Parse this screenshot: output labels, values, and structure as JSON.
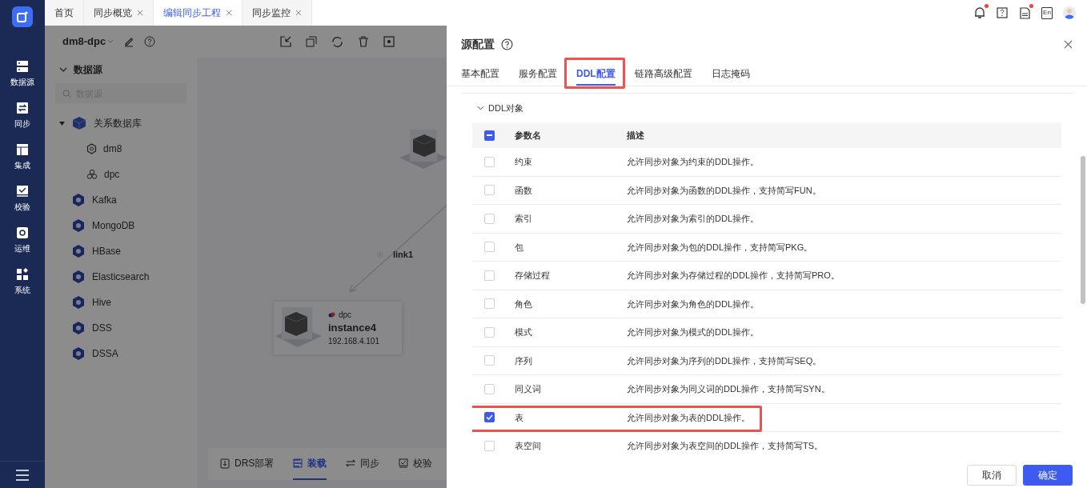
{
  "nav": {
    "items": [
      {
        "label": "数据源"
      },
      {
        "label": "同步"
      },
      {
        "label": "集成"
      },
      {
        "label": "校验"
      },
      {
        "label": "运维"
      },
      {
        "label": "系统"
      }
    ]
  },
  "tabs": [
    {
      "label": "首页",
      "closable": false,
      "selected": false
    },
    {
      "label": "同步概览",
      "closable": true,
      "selected": false
    },
    {
      "label": "编辑同步工程",
      "closable": true,
      "selected": true
    },
    {
      "label": "同步监控",
      "closable": true,
      "selected": false
    }
  ],
  "header_icons": [
    {
      "kind": "bell",
      "badge": true
    },
    {
      "kind": "help",
      "badge": false
    },
    {
      "kind": "log",
      "badge": true
    },
    {
      "kind": "lang",
      "label": "En",
      "badge": false
    },
    {
      "kind": "avatar",
      "badge": false
    }
  ],
  "project": {
    "name": "dm8-dpc"
  },
  "datasource_panel": {
    "title": "数据源",
    "expanded": true,
    "search": {
      "placeholder": "数据源"
    },
    "tree": [
      {
        "label": "关系数据库",
        "expanded": true,
        "children": [
          {
            "label": "dm8"
          },
          {
            "label": "dpc"
          }
        ]
      },
      {
        "label": "Kafka"
      },
      {
        "label": "MongoDB"
      },
      {
        "label": "HBase"
      },
      {
        "label": "Elasticsearch"
      },
      {
        "label": "Hive"
      },
      {
        "label": "DSS"
      },
      {
        "label": "DSSA"
      }
    ]
  },
  "canvas": {
    "link": {
      "label": "link1"
    },
    "node": {
      "type": "dpc",
      "name": "instance4",
      "ip": "192.168.4.101"
    }
  },
  "bottom_tabs": [
    {
      "label": "DRS部署",
      "selected": false
    },
    {
      "label": "装载",
      "selected": true
    },
    {
      "label": "同步",
      "selected": false
    },
    {
      "label": "校验",
      "selected": false
    }
  ],
  "drawer": {
    "title": "源配置",
    "tabs": [
      {
        "label": "基本配置",
        "selected": false,
        "highlighted": false
      },
      {
        "label": "服务配置",
        "selected": false,
        "highlighted": false
      },
      {
        "label": "DDL配置",
        "selected": true,
        "highlighted": true
      },
      {
        "label": "链路高级配置",
        "selected": false,
        "highlighted": false
      },
      {
        "label": "日志掩码",
        "selected": false,
        "highlighted": false
      }
    ],
    "section": {
      "title": "DDL对象",
      "expanded": true,
      "select_all_indeterminate": true,
      "columns": [
        "参数名",
        "描述"
      ],
      "rows": [
        {
          "name": "约束",
          "description": "允许同步对象为约束的DDL操作。",
          "checked": false,
          "highlighted": false
        },
        {
          "name": "函数",
          "description": "允许同步对象为函数的DDL操作，支持简写FUN。",
          "checked": false,
          "highlighted": false
        },
        {
          "name": "索引",
          "description": "允许同步对象为索引的DDL操作。",
          "checked": false,
          "highlighted": false
        },
        {
          "name": "包",
          "description": "允许同步对象为包的DDL操作，支持简写PKG。",
          "checked": false,
          "highlighted": false
        },
        {
          "name": "存储过程",
          "description": "允许同步对象为存储过程的DDL操作，支持简写PRO。",
          "checked": false,
          "highlighted": false
        },
        {
          "name": "角色",
          "description": "允许同步对象为角色的DDL操作。",
          "checked": false,
          "highlighted": false
        },
        {
          "name": "模式",
          "description": "允许同步对象为模式的DDL操作。",
          "checked": false,
          "highlighted": false
        },
        {
          "name": "序列",
          "description": "允许同步对象为序列的DDL操作，支持简写SEQ。",
          "checked": false,
          "highlighted": false
        },
        {
          "name": "同义词",
          "description": "允许同步对象为同义词的DDL操作，支持简写SYN。",
          "checked": false,
          "highlighted": false
        },
        {
          "name": "表",
          "description": "允许同步对象为表的DDL操作。",
          "checked": true,
          "highlighted": true
        },
        {
          "name": "表空间",
          "description": "允许同步对象为表空间的DDL操作，支持简写TS。",
          "checked": false,
          "highlighted": false
        }
      ]
    },
    "buttons": [
      {
        "label": "取消",
        "kind": "secondary"
      },
      {
        "label": "确定",
        "kind": "primary"
      }
    ]
  }
}
